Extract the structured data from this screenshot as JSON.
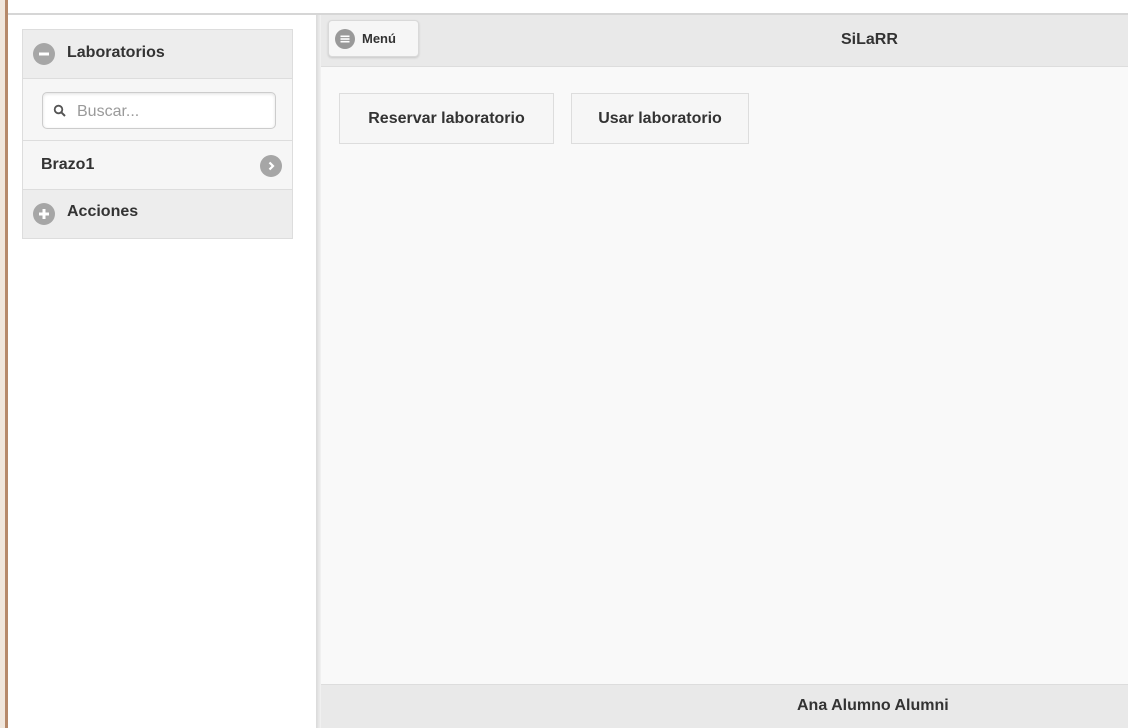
{
  "panel": {
    "laboratories_header": "Laboratorios",
    "search": {
      "placeholder": "Buscar...",
      "value": ""
    },
    "items": [
      {
        "label": "Brazo1",
        "icon": "chevron-right-icon"
      }
    ],
    "actions_header": "Acciones",
    "icons": {
      "header": "minus-circle-icon",
      "actions": "plus-circle-icon",
      "search": "search-icon"
    }
  },
  "header": {
    "menu_label": "Menú",
    "menu_icon": "hamburger-menu-icon",
    "title": "SiLaRR"
  },
  "main": {
    "buttons": [
      {
        "label": "Reservar laboratorio"
      },
      {
        "label": "Usar laboratorio"
      }
    ]
  },
  "footer": {
    "user_name": "Ana Alumno Alumni"
  },
  "colors": {
    "bar_background": "#e9e9e9",
    "page_background": "#f9f9f9",
    "icon_gray": "#a6a6a6",
    "text": "#333333"
  }
}
